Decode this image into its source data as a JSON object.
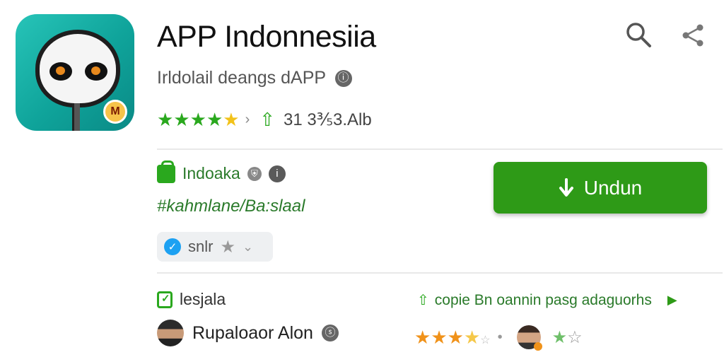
{
  "app": {
    "title": "APP Indonnesiia",
    "subtitle": "Irldolail deangs dAPP",
    "info_glyph": "ⓘ",
    "rating_text": "31 3⅗3.Alb",
    "icon_badge": "M"
  },
  "header": {
    "search_icon": "search-icon",
    "share_icon": "share-icon"
  },
  "developer": {
    "name": "Indoaka",
    "hashtag": "#kahmlane/Ba:slaal",
    "chip_label": "snlr"
  },
  "install": {
    "label": "Undun"
  },
  "section": {
    "label": "lesjala",
    "promo_text": "copie Bn oannin pasg adaguorhs"
  },
  "review": {
    "user_name": "Rupaloaor Alon",
    "rating": 3.5,
    "rating_max": 5
  },
  "colors": {
    "accent_green": "#2e9a17",
    "icon_teal": "#14b0a6",
    "star_orange": "#f0921a"
  }
}
